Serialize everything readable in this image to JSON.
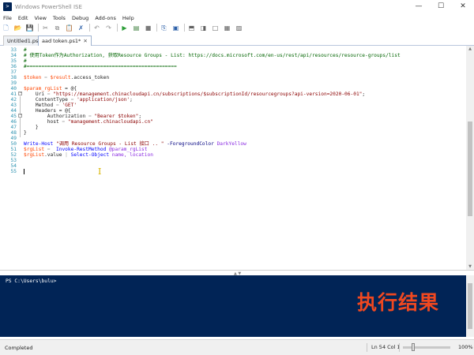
{
  "window": {
    "title": "Windows PowerShell ISE",
    "app_icon": "powershell-icon",
    "controls": {
      "minimize": "—",
      "maximize": "☐",
      "close": "✕"
    }
  },
  "menu": [
    "File",
    "Edit",
    "View",
    "Tools",
    "Debug",
    "Add-ons",
    "Help"
  ],
  "toolbar": [
    {
      "name": "new-file-icon",
      "glyph": "🗋",
      "color": "#5a8ac6"
    },
    {
      "name": "open-folder-icon",
      "glyph": "📂",
      "color": "#d9a441"
    },
    {
      "name": "save-icon",
      "glyph": "💾",
      "color": "#3a6ea5"
    },
    {
      "name": "cut-icon",
      "glyph": "✂",
      "color": "#7f7f7f"
    },
    {
      "name": "copy-icon",
      "glyph": "⧉",
      "color": "#7f7f7f"
    },
    {
      "name": "paste-icon",
      "glyph": "📋",
      "color": "#b98a3a"
    },
    {
      "name": "clear-console-icon",
      "glyph": "✗",
      "color": "#2b5fa8"
    },
    {
      "name": "undo-icon",
      "glyph": "↶",
      "color": "#909090"
    },
    {
      "name": "redo-icon",
      "glyph": "↷",
      "color": "#909090"
    },
    {
      "name": "run-script-icon",
      "glyph": "▶",
      "color": "#2e9e3a"
    },
    {
      "name": "run-selection-icon",
      "glyph": "▤",
      "color": "#3b7d3b"
    },
    {
      "name": "stop-icon",
      "glyph": "■",
      "color": "#7a7a7a"
    },
    {
      "name": "remote-powershell-icon",
      "glyph": "⎘",
      "color": "#2b5fa8"
    },
    {
      "name": "start-powershell-icon",
      "glyph": "▣",
      "color": "#2b5fa8"
    },
    {
      "name": "show-script-top-icon",
      "glyph": "⬒",
      "color": "#606060"
    },
    {
      "name": "show-script-right-icon",
      "glyph": "◨",
      "color": "#606060"
    },
    {
      "name": "show-script-maximized-icon",
      "glyph": "□",
      "color": "#606060"
    },
    {
      "name": "show-commands-icon",
      "glyph": "▦",
      "color": "#606060"
    },
    {
      "name": "show-addon-icon",
      "glyph": "▨",
      "color": "#606060"
    }
  ],
  "tabs": [
    {
      "label": "Untitled1.ps1*",
      "active": false
    },
    {
      "label": "aad token.ps1*",
      "active": true
    }
  ],
  "editor": {
    "line_numbers": [
      "33",
      "34",
      "35",
      "36",
      "37",
      "38",
      "39",
      "40",
      "41",
      "42",
      "43",
      "44",
      "45",
      "46",
      "47",
      "48",
      "49",
      "50",
      "51",
      "52",
      "53",
      "54",
      "55"
    ],
    "lines": {
      "l33": "#",
      "l34": "# 使用Token作为Authorization, 获取Resource Groups - List: https://docs.microsoft.com/en-us/rest/api/resources/resource-groups/list",
      "l35": "#",
      "l36": "#===================================================",
      "l37": "",
      "l38_var": "$token",
      "l38_op": " = ",
      "l38_rest": "$result",
      "l38_prop": ".access_token",
      "l39": "",
      "l40_var": "$param_rgList",
      "l40_rest": " = @{",
      "l41_key": "    Uri",
      "l41_op": " = ",
      "l41_str": "\"https://management.chinacloudapi.cn/subscriptions/$subscriptionId/resourcegroups?api-version=2020-06-01\"",
      "l41_end": ";",
      "l42_key": "    ContentType",
      "l42_op": " = ",
      "l42_str": "'application/json'",
      "l42_end": ";",
      "l43_key": "    Method",
      "l43_op": " = ",
      "l43_str": "'GET'",
      "l44_key": "    Headers",
      "l44_rest": " = @{",
      "l45_key": "        Authorization",
      "l45_op": " = ",
      "l45_str": "\"Bearer $token\"",
      "l45_end": ";",
      "l46_key": "        host",
      "l46_op": " = ",
      "l46_str": "\"management.chinacloudapi.cn\"",
      "l47": "    }",
      "l48": "}",
      "l49": "",
      "l50_cmd": "Write-Host",
      "l50_str": " \"调用 Resource Groups - List 接口 .. \"",
      "l50_par": " -ForegroundColor",
      "l50_arg": " DarkYellow",
      "l51_var": "$rgList",
      "l51_op": " = ",
      "l51_cmd": " Invoke-RestMethod",
      "l51_arg": " @param_rgList",
      "l52_var": "$rgList",
      "l52_prop": ".value",
      "l52_op": " | ",
      "l52_cmd": "Select-Object",
      "l52_arg": " name, location",
      "l53": "",
      "l54": "",
      "l55": ""
    }
  },
  "console": {
    "prompt": "PS C:\\Users\\bulu>",
    "background": "#012456"
  },
  "overlay_caption": "执行结果",
  "status": {
    "text": "Completed",
    "position": "Ln 54  Col 1",
    "zoom": "100%",
    "zoom_level": 1.0
  }
}
